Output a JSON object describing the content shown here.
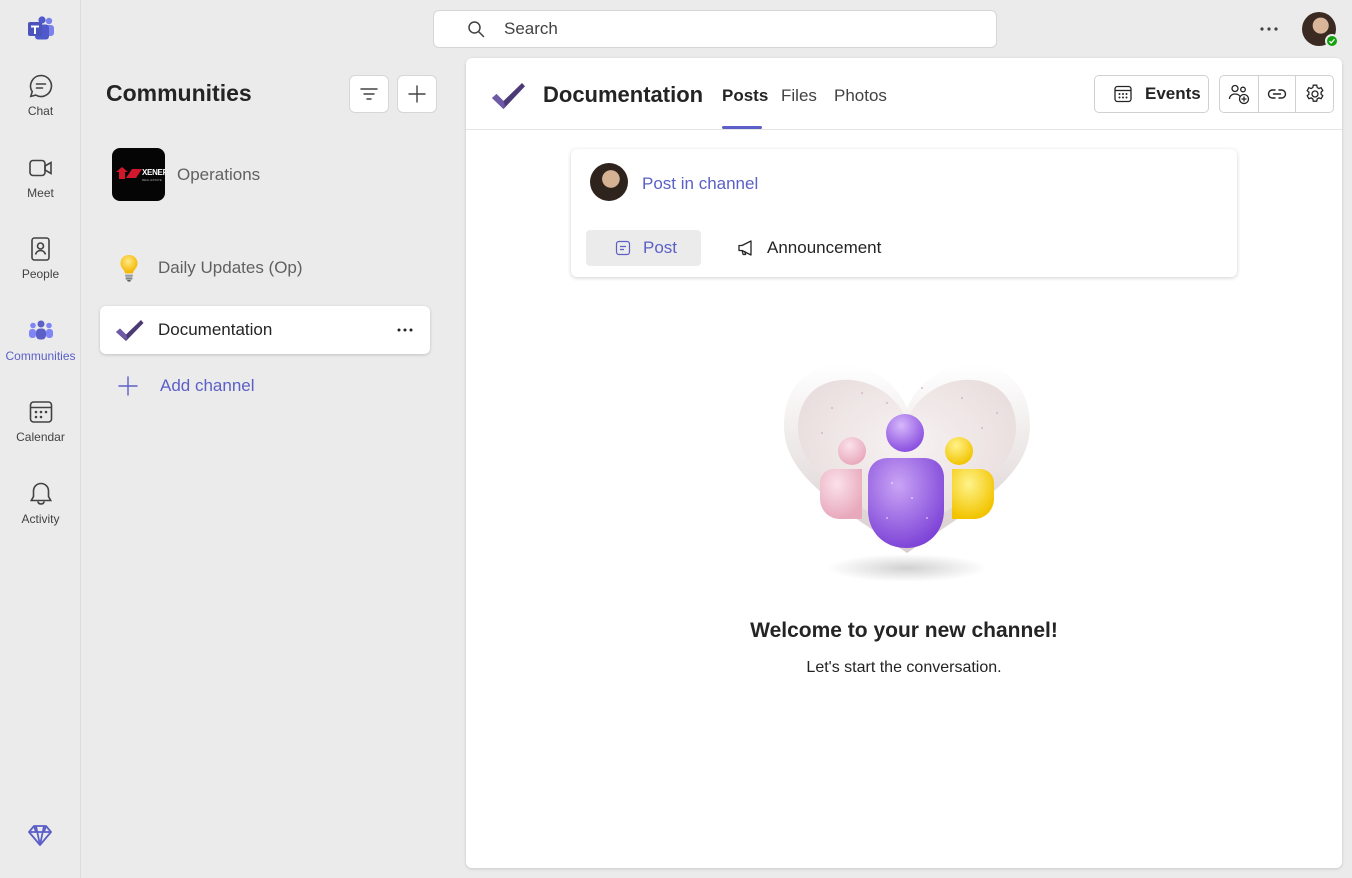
{
  "rail": {
    "items": [
      {
        "label": "Chat",
        "icon": "chat-icon"
      },
      {
        "label": "Meet",
        "icon": "video-icon"
      },
      {
        "label": "People",
        "icon": "people-icon"
      },
      {
        "label": "Communities",
        "icon": "communities-icon",
        "active": true
      },
      {
        "label": "Calendar",
        "icon": "calendar-icon"
      },
      {
        "label": "Activity",
        "icon": "bell-icon"
      }
    ],
    "accent": "#5b5fc7"
  },
  "search": {
    "placeholder": "Search"
  },
  "pane": {
    "title": "Communities",
    "community": {
      "name": "Operations",
      "logo_text": "XENERC",
      "logo_sub": "REAL ESTATE"
    },
    "channels": [
      {
        "label": "Daily Updates (Op)",
        "icon": "lightbulb-icon"
      },
      {
        "label": "Documentation",
        "icon": "checkmark-icon",
        "selected": true
      }
    ],
    "add_channel": "Add channel"
  },
  "main": {
    "title": "Documentation",
    "tabs": [
      "Posts",
      "Files",
      "Photos"
    ],
    "active_tab": "Posts",
    "events_label": "Events",
    "compose": {
      "link": "Post in channel",
      "post_label": "Post",
      "announcement_label": "Announcement"
    },
    "welcome": {
      "title": "Welcome to your new channel!",
      "subtitle": "Let's start the conversation."
    }
  }
}
